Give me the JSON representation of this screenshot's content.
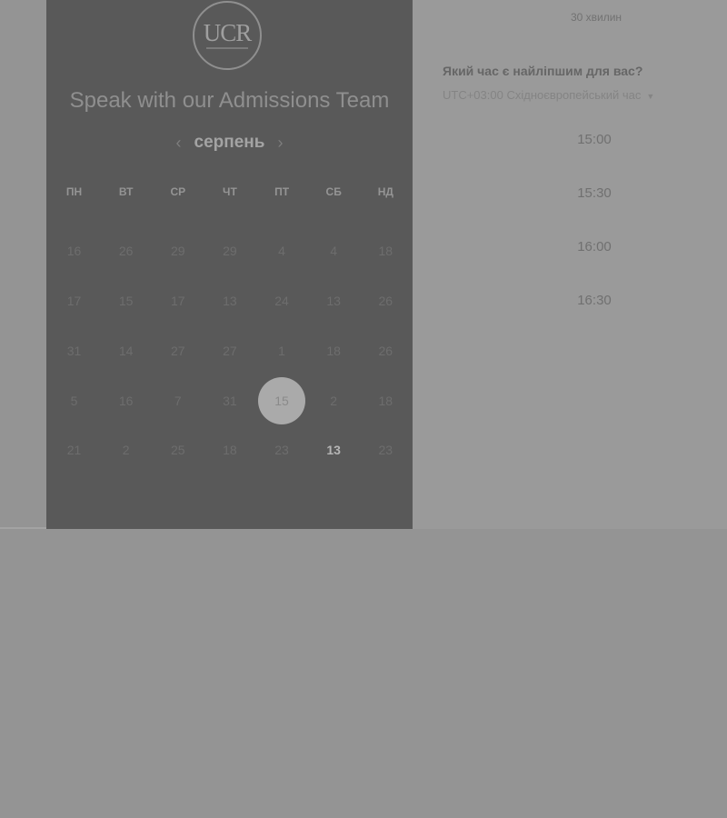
{
  "calendar": {
    "title": "Speak with our Admissions Team",
    "logo_text": "UCR",
    "month": "серпень",
    "prev_icon": "chevron-left-icon",
    "next_icon": "chevron-right-icon",
    "weekdays": [
      "ПН",
      "ВТ",
      "СР",
      "ЧТ",
      "ПТ",
      "СБ",
      "НД"
    ],
    "weeks": [
      [
        "16",
        "26",
        "29",
        "29",
        "4",
        "4",
        "18"
      ],
      [
        "17",
        "15",
        "17",
        "13",
        "24",
        "13",
        "26"
      ],
      [
        "31",
        "14",
        "27",
        "27",
        "1",
        "18",
        "26"
      ],
      [
        "5",
        "16",
        "7",
        "31",
        "15",
        "2",
        "18"
      ],
      [
        "21",
        "2",
        "25",
        "18",
        "23",
        "13",
        "23"
      ]
    ],
    "selected": [
      3,
      4
    ],
    "available": [
      4,
      5
    ]
  },
  "scheduler": {
    "duration": "30 хвилин",
    "question": "Який час є найліпшим для вас?",
    "timezone": "UTC+03:00 Східноєвропейський час",
    "timezone_icon": "caret-down-icon",
    "slots": [
      "15:00",
      "15:30",
      "16:00",
      "16:30"
    ]
  },
  "colors": {
    "overlay": "#949494",
    "card": "#595959",
    "selected_circle": "#aaaaaa"
  }
}
